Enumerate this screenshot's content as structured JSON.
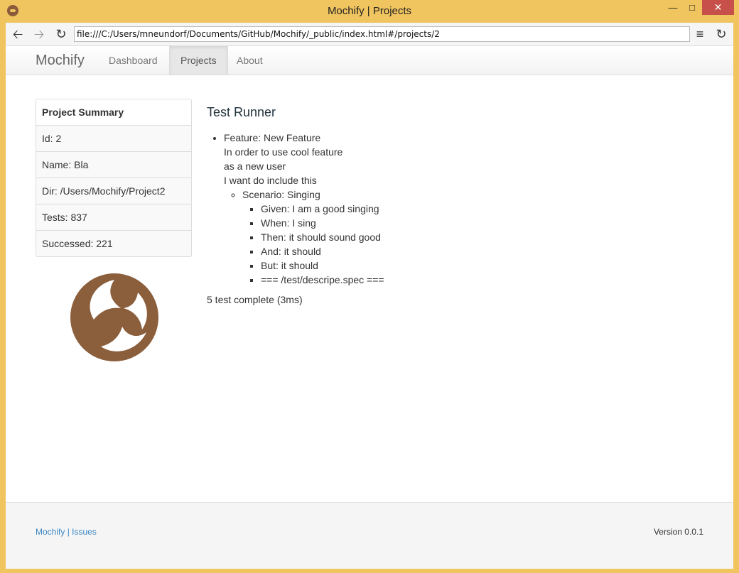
{
  "window": {
    "title": "Mochify | Projects",
    "min": "—",
    "max": "□",
    "close": "✕"
  },
  "browser": {
    "url": "file:///C:/Users/mneundorf/Documents/GitHub/Mochify/_public/index.html#/projects/2",
    "back_icon": "🡠",
    "forward_icon": "🡢",
    "reload_icon": "↻",
    "menu_icon": "≡"
  },
  "navbar": {
    "brand": "Mochify",
    "items": [
      {
        "label": "Dashboard"
      },
      {
        "label": "Projects"
      },
      {
        "label": "About"
      }
    ]
  },
  "summary": {
    "title": "Project Summary",
    "rows": [
      "Id: 2",
      "Name: Bla",
      "Dir: /Users/Mochify/Project2",
      "Tests: 837",
      "Successed: 221"
    ]
  },
  "runner": {
    "title": "Test Runner",
    "feature": {
      "lines": [
        "Feature: New Feature",
        "In order to use cool feature",
        "as a new user",
        "I want do include this"
      ],
      "scenario": "Scenario: Singing",
      "steps": [
        "Given: I am a good singing",
        "When: I sing",
        "Then: it should sound good",
        "And: it should",
        "But: it should",
        "=== /test/descripe.spec ==="
      ]
    },
    "result": "5 test complete (3ms)"
  },
  "footer": {
    "link1": "Mochify",
    "separator": "|",
    "link2": "Issues",
    "version": "Version 0.0.1"
  },
  "colors": {
    "logo": "#8b5e3c",
    "frame": "#f0c45f",
    "link": "#3a86c4"
  }
}
